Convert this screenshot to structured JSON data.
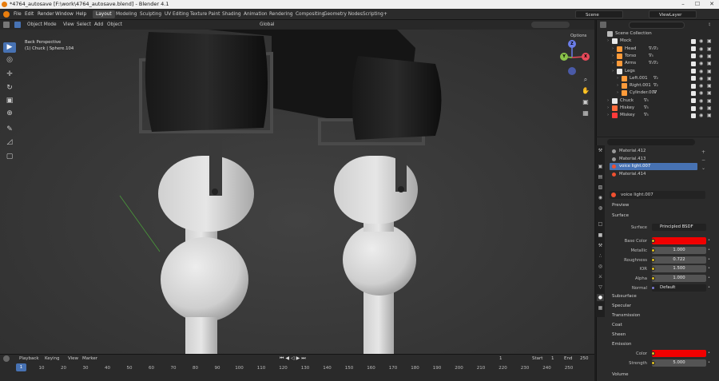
{
  "window": {
    "title": "*4764_autosave [F:\\work\\4764_autosave.blend] - Blender 4.1",
    "min": "–",
    "max": "☐",
    "close": "✕"
  },
  "menu": {
    "items": [
      "File",
      "Edit",
      "Render",
      "Window",
      "Help"
    ]
  },
  "workspaces": [
    {
      "label": "Layout",
      "active": true
    },
    {
      "label": "Modeling"
    },
    {
      "label": "Sculpting"
    },
    {
      "label": "UV Editing"
    },
    {
      "label": "Texture Paint"
    },
    {
      "label": "Shading"
    },
    {
      "label": "Animation"
    },
    {
      "label": "Rendering"
    },
    {
      "label": "Compositing"
    },
    {
      "label": "Geometry Nodes"
    },
    {
      "label": "Scripting"
    },
    {
      "label": "+"
    }
  ],
  "scene": {
    "name": "Scene",
    "view_layer": "ViewLayer"
  },
  "viewport": {
    "mode": "Object Mode",
    "menus": [
      "View",
      "Select",
      "Add",
      "Object"
    ],
    "transform": "Global",
    "options": "Options",
    "info_line1": "Back Perspective",
    "info_line2": "(1) Chuck | Sphere.104",
    "gizmo": {
      "x": "X",
      "y": "Y",
      "z": "Z"
    }
  },
  "timeline": {
    "menus": [
      "Playback",
      "Keying",
      "View",
      "Marker"
    ],
    "current_frame": "1",
    "start_label": "Start",
    "start": "1",
    "end_label": "End",
    "end": "250",
    "ticks": [
      "10",
      "20",
      "30",
      "40",
      "50",
      "60",
      "70",
      "80",
      "90",
      "100",
      "110",
      "120",
      "130",
      "140",
      "150",
      "160",
      "170",
      "180",
      "190",
      "200",
      "210",
      "220",
      "230",
      "240",
      "250"
    ],
    "frame_indicator": "1"
  },
  "outliner": {
    "search_placeholder": "",
    "rows": [
      {
        "name": "Scene Collection",
        "indent": 0,
        "icon": "#bbbbbb"
      },
      {
        "name": "Mock",
        "indent": 1,
        "icon": "#e8e8e8"
      },
      {
        "name": "Head",
        "indent": 2,
        "icon": "#ff9b3a",
        "extra": "∇₄∇₂"
      },
      {
        "name": "Torso",
        "indent": 2,
        "icon": "#ff9b3a",
        "extra": "∇₅"
      },
      {
        "name": "Arms",
        "indent": 2,
        "icon": "#ff9b3a",
        "extra": "∇₄∇₂"
      },
      {
        "name": "Legs",
        "indent": 2,
        "icon": "#e8e8e8"
      },
      {
        "name": "Left.001",
        "indent": 3,
        "icon": "#ff9b3a",
        "extra": "∇₂"
      },
      {
        "name": "Right.001",
        "indent": 3,
        "icon": "#ff9b3a",
        "extra": "∇₂"
      },
      {
        "name": "Cylinder.007",
        "indent": 3,
        "icon": "#ff9b3a",
        "extra": "∇"
      },
      {
        "name": "Chuck",
        "indent": 1,
        "icon": "#e8e8e8",
        "extra": "∇₅"
      },
      {
        "name": "Hiskey",
        "indent": 1,
        "icon": "#ff6a3a",
        "extra": "∇₅"
      },
      {
        "name": "Miskey",
        "indent": 1,
        "icon": "#ff3a3a",
        "extra": "∇₅"
      }
    ]
  },
  "properties": {
    "slots": [
      {
        "name": "Material.412",
        "color": "#9a9a9a"
      },
      {
        "name": "Material.413",
        "color": "#9a9a9a"
      },
      {
        "name": "voice light.007",
        "color": "#f05030",
        "selected": true
      },
      {
        "name": "Material.414",
        "color": "#f05030"
      }
    ],
    "material_name": "voice light.007",
    "sections": {
      "preview": "Preview",
      "surface": "Surface",
      "subsurface": "Subsurface",
      "specular": "Specular",
      "transmission": "Transmission",
      "coat": "Coat",
      "sheen": "Sheen",
      "emission": "Emission",
      "volume": "Volume"
    },
    "surface": {
      "label": "Surface",
      "value": "Principled BSDF"
    },
    "fields": [
      {
        "label": "Base Color",
        "value": "",
        "kind": "color",
        "color": "#f10000"
      },
      {
        "label": "Metallic",
        "value": "1.000",
        "kind": "num"
      },
      {
        "label": "Roughness",
        "value": "0.722",
        "kind": "num"
      },
      {
        "label": "IOR",
        "value": "1.500",
        "kind": "num"
      },
      {
        "label": "Alpha",
        "value": "1.000",
        "kind": "num"
      },
      {
        "label": "Normal",
        "value": "Default",
        "kind": "dark"
      }
    ],
    "emission": [
      {
        "label": "Color",
        "value": "",
        "kind": "color",
        "color": "#f10000"
      },
      {
        "label": "Strength",
        "value": "5.000",
        "kind": "num"
      }
    ]
  },
  "colors": {
    "accent": "#4772b3",
    "emission": "#f10000"
  }
}
